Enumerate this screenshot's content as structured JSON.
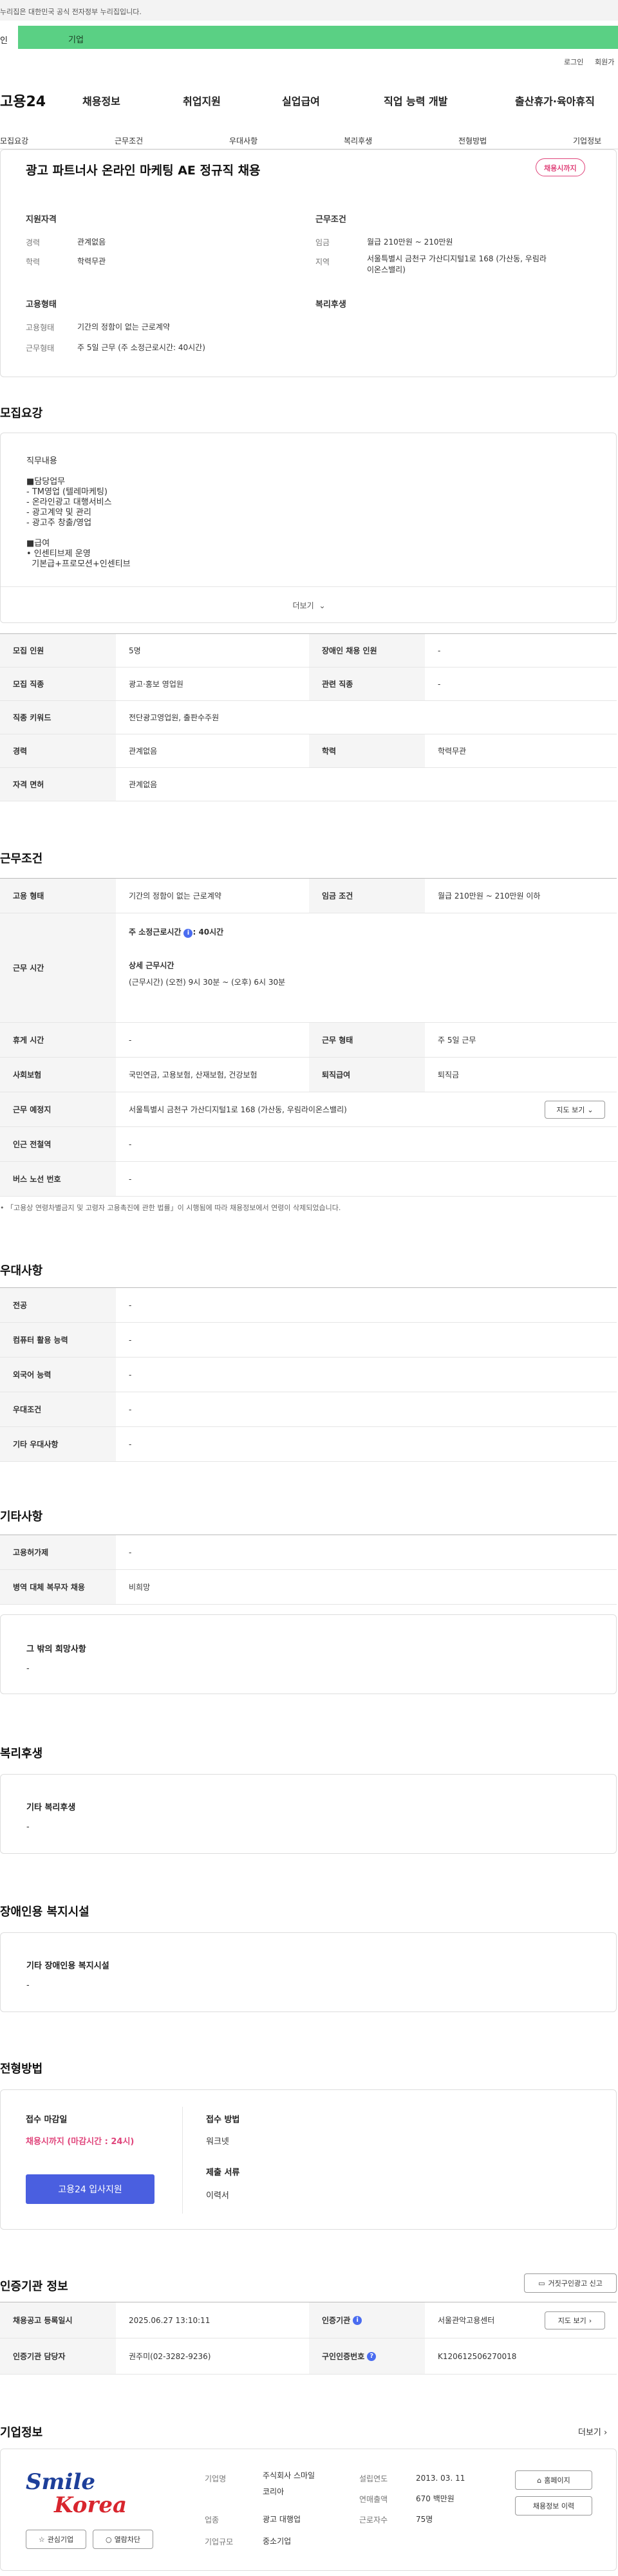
{
  "gov_notice": "누리집은 대한민국 공식 전자정부 누리집입니다.",
  "tabs": {
    "personal": "인",
    "company": "기업"
  },
  "util": {
    "login": "로그인",
    "signup": "회원가"
  },
  "logo": "고용24",
  "gnb": [
    "채용정보",
    "취업지원",
    "실업급여",
    "직업 능력 개발",
    "출산휴가·육아휴직"
  ],
  "subnav": [
    "모집요강",
    "근무조건",
    "우대사항",
    "복리후생",
    "전형방법",
    "기업정보"
  ],
  "summary": {
    "title": "광고 파트너사 온라인 마케팅 AE 정규직 채용",
    "badge": "채용시까지",
    "qual_heading": "지원자격",
    "career_k": "경력",
    "career_v": "관계없음",
    "edu_k": "학력",
    "edu_v": "학력무관",
    "cond_heading": "근무조건",
    "wage_k": "임금",
    "wage_v": "월급 210만원 ~ 210만원",
    "region_k": "지역",
    "region_v1": "서울특별시 금천구 가산디지털1로 168 (가산동, 우림라",
    "region_v2": "이온스밸리)",
    "emp_heading": "고용형태",
    "emptype_k": "고용형태",
    "emptype_v": "기간의 정함이 없는 근로계약",
    "worktype_k": "근무형태",
    "worktype_v": "주 5일 근무 (주 소정근로시간: 40시간)",
    "welfare_heading": "복리후생"
  },
  "recruit": {
    "section_title": "모집요강",
    "desc": "직무내용\n\n■담당업무\n- TM영업 (텔레마케팅)\n- 온라인광고 대행서비스\n- 광고계약 및 관리\n- 광고주 창출/영업\n\n■급여\n• 인센티브제 운영\n  기본급+프로모션+인센티브",
    "more": "더보기",
    "count_k": "모집 인원",
    "count_v": "5명",
    "disabled_k": "장애인 채용 인원",
    "disabled_v": "-",
    "job_k": "모집 직종",
    "job_v": "광고·홍보 영업원",
    "rel_k": "관련 직종",
    "rel_v": "-",
    "kw_k": "직종 키워드",
    "kw_v": "전단광고영업원, 출판수주원",
    "career_k": "경력",
    "career_v": "관계없음",
    "edu_k": "학력",
    "edu_v": "학력무관",
    "license_k": "자격 면허",
    "license_v": "관계없음"
  },
  "conditions": {
    "section_title": "근무조건",
    "emp_k": "고용 형태",
    "emp_v": "기간의 정함이 없는 근로계약",
    "wage_k": "임금 조건",
    "wage_v": "월급 210만원 ~ 210만원 이하",
    "hours_k": "근무 시간",
    "hours_v1": "주 소정근로시간",
    "hours_v1b": ": 40시간",
    "hours_v2": "상세 근무시간",
    "hours_v3": "(근무시간) (오전) 9시 30분 ~ (오후) 6시 30분",
    "rest_k": "휴게 시간",
    "rest_v": "-",
    "worktype_k": "근무 형태",
    "worktype_v": "주 5일 근무",
    "insurance_k": "사회보험",
    "insurance_v": "국민연금, 고용보험, 산재보험, 건강보험",
    "severance_k": "퇴직급여",
    "severance_v": "퇴직금",
    "location_k": "근무 예정지",
    "location_v": "서울특별시 금천구 가산디지털1로 168 (가산동, 우림라이온스밸리)",
    "map_btn": "지도 보기",
    "subway_k": "인근 전철역",
    "subway_v": "-",
    "bus_k": "버스 노선 번호",
    "bus_v": "-",
    "note": "「고용상 연령차별금지 및 고령자 고용촉진에 관한 법률」이 시행됨에 따라 채용정보에서 연령이 삭제되었습니다."
  },
  "preferences": {
    "section_title": "우대사항",
    "major_k": "전공",
    "major_v": "-",
    "computer_k": "컴퓨터 활용 능력",
    "computer_v": "-",
    "lang_k": "외국어 능력",
    "lang_v": "-",
    "pref_k": "우대조건",
    "pref_v": "-",
    "etc_k": "기타 우대사항",
    "etc_v": "-"
  },
  "etc": {
    "section_title": "기타사항",
    "permit_k": "고용허가제",
    "permit_v": "-",
    "military_k": "병역 대체 복무자 채용",
    "military_v": "비희망",
    "wish_title": "그 밖의 희망사항",
    "wish_v": "-"
  },
  "welfare": {
    "section_title": "복리후생",
    "box_title": "기타 복리후생",
    "box_v": "-"
  },
  "disabled_fac": {
    "section_title": "장애인용 복지시설",
    "box_title": "기타 장애인용 복지시설",
    "box_v": "-"
  },
  "selection": {
    "section_title": "전형방법",
    "deadline_k": "접수 마감일",
    "deadline_v": "채용시까지 (마감시간 : 24시)",
    "apply_btn": "고용24 입사지원",
    "method_k": "접수 방법",
    "method_v": "워크넷",
    "docs_k": "제출 서류",
    "docs_v": "이력서"
  },
  "cert": {
    "section_title": "인증기관 정보",
    "report_btn": "거짓구인광고 신고",
    "reg_k": "채용공고 등록일시",
    "reg_v": "2025.06.27 13:10:11",
    "org_k": "인증기관",
    "org_v": "서울관악고용센터",
    "map_btn": "지도 보기",
    "mgr_k": "인증기관 담당자",
    "mgr_v": "권주미(02-3282-9236)",
    "id_k": "구인인증번호",
    "id_v": "K120612506270018"
  },
  "company": {
    "section_title": "기업정보",
    "more": "더보기",
    "logo_top": "Smile",
    "logo_bottom": "Korea",
    "fav_btn": "관심기업",
    "block_btn": "열람차단",
    "name_k": "기업명",
    "name_v1": "주식회사 스마일",
    "name_v2": "코리아",
    "industry_k": "업종",
    "industry_v": "광고 대행업",
    "scale_k": "기업규모",
    "scale_v": "중소기업",
    "founded_k": "설립연도",
    "founded_v": "2013. 03. 11",
    "sales_k": "연매출액",
    "sales_v": "670 백만원",
    "staff_k": "근로자수",
    "staff_v": "75명",
    "home_btn": "홈페이지",
    "jobs_btn": "채용정보 이력"
  },
  "colors": {
    "accent": "#4a5fe0",
    "company_tab": "#5ad084",
    "badge": "#e0457b",
    "deadline": "#e0457b"
  }
}
